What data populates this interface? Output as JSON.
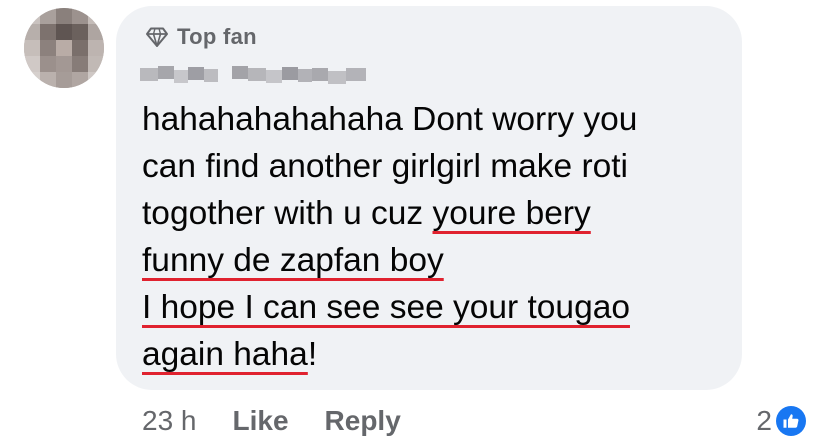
{
  "comment": {
    "badge_label": "Top fan",
    "badge_icon": "diamond-icon",
    "text": {
      "line1": "hahahahahahaha Dont worry you",
      "line2": "can find another girlgirl make roti",
      "line3_plain": "togother with u cuz ",
      "line3_underlined": "youre bery",
      "line4_underlined": "funny de zapfan boy",
      "line5_underlined": "I hope I can see see your tougao",
      "line6_underlined": "again haha",
      "line6_end": "!"
    },
    "underline_color": "#e0222f",
    "bubble_color": "#f0f2f5"
  },
  "actions": {
    "timestamp": "23 h",
    "like_label": "Like",
    "reply_label": "Reply"
  },
  "reactions": {
    "count": "2",
    "icon": "thumbs-up-icon",
    "accent": "#1877f2"
  }
}
